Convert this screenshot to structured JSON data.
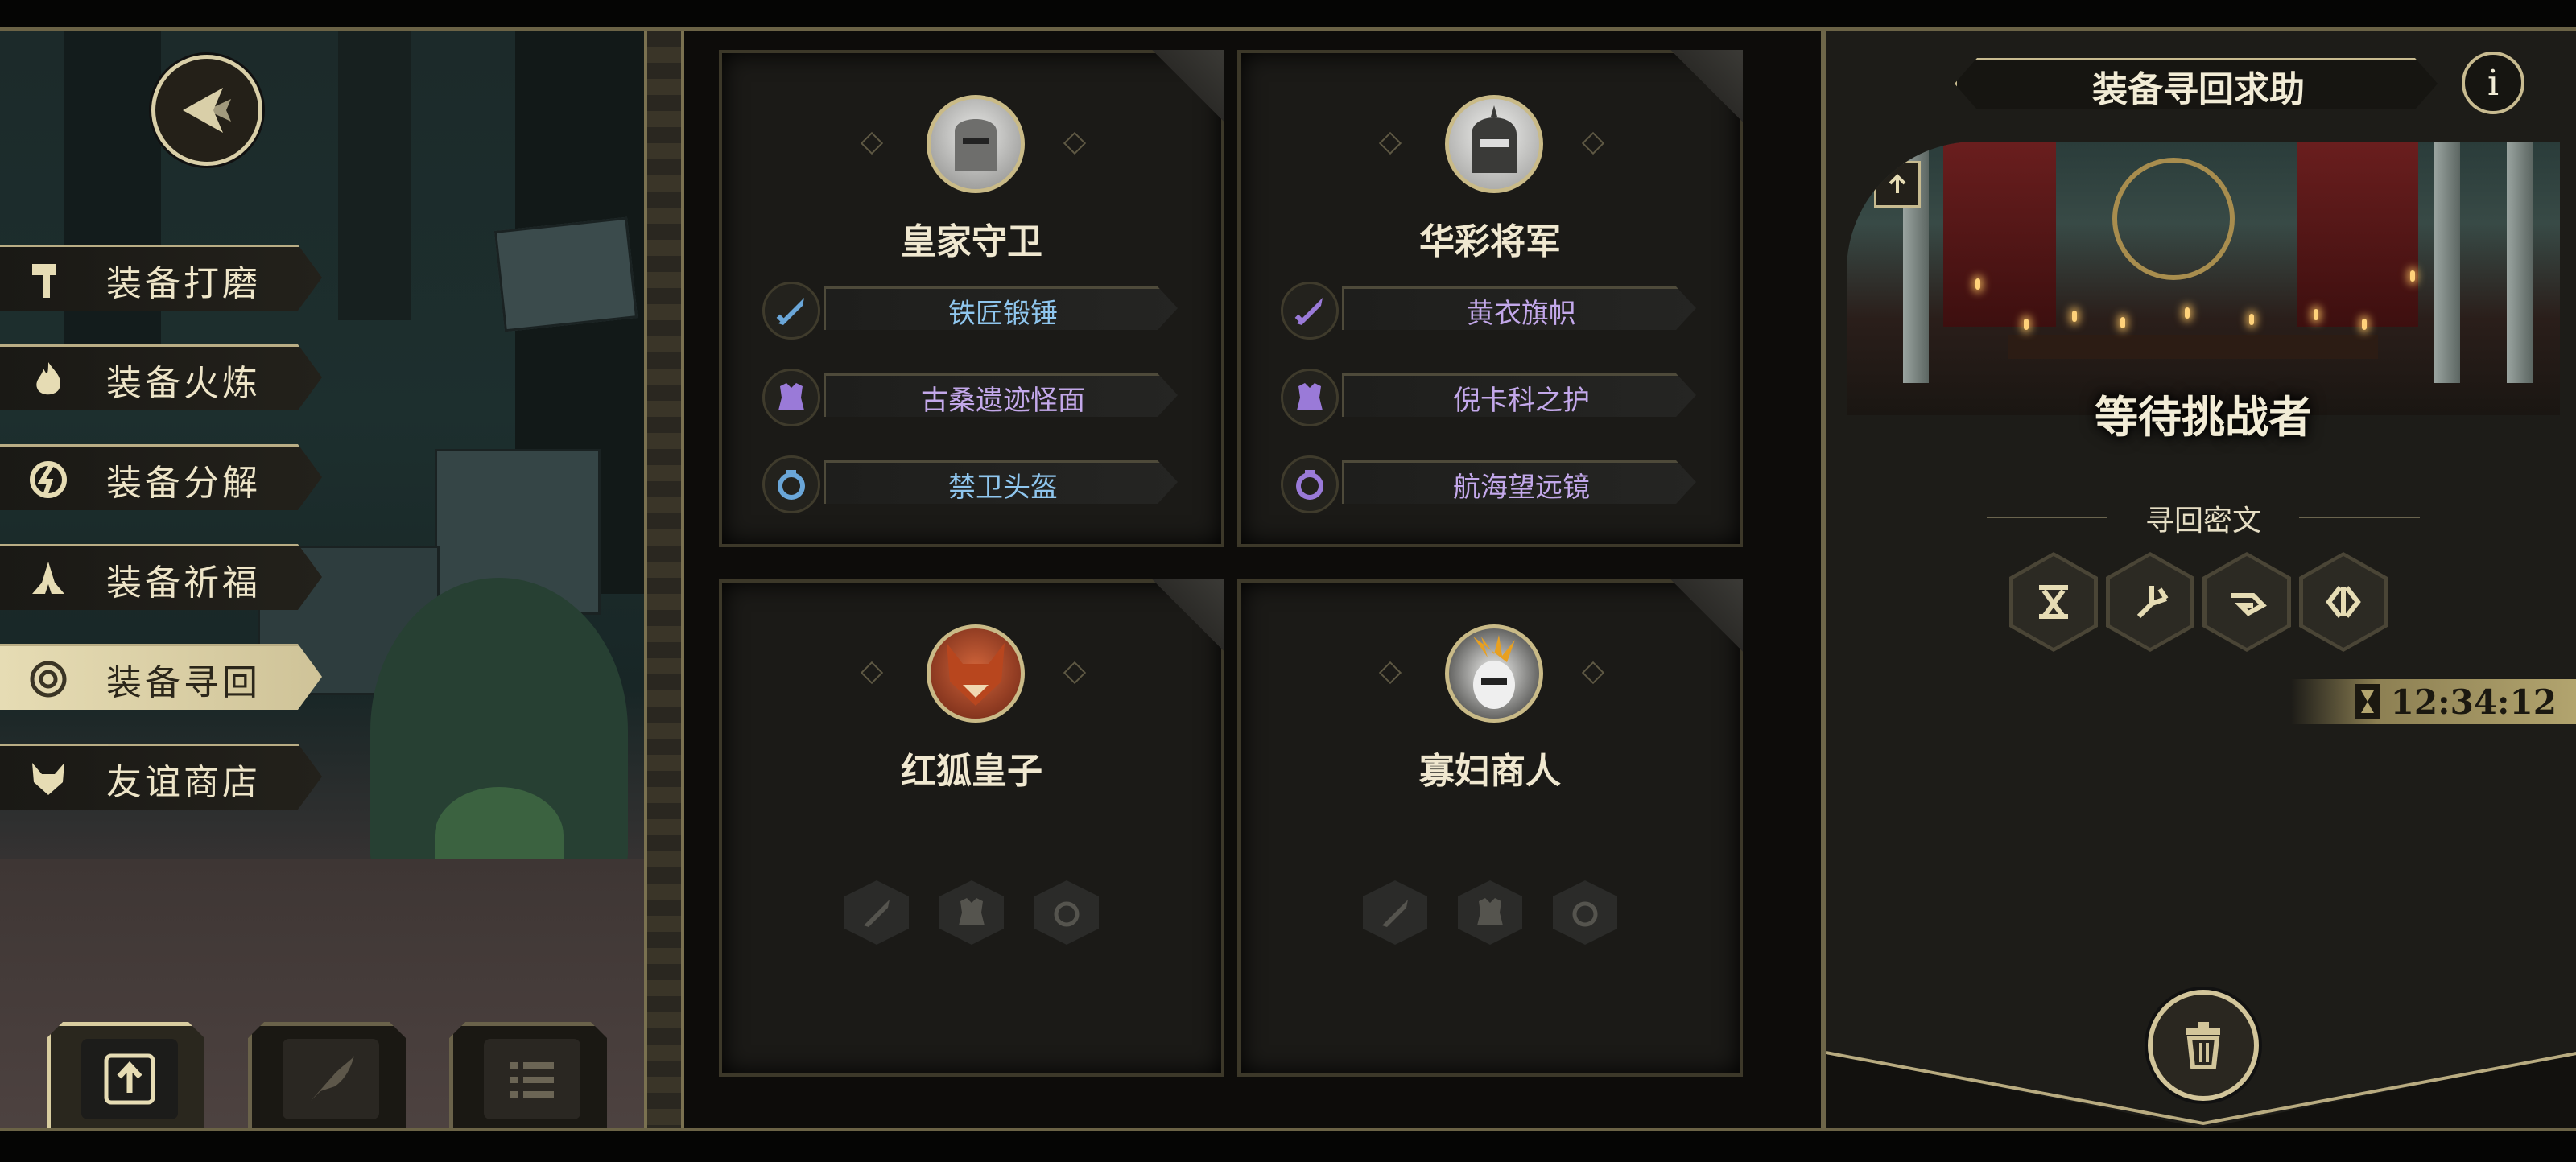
{
  "menu": {
    "items": [
      {
        "label": "装备打磨",
        "icon": "hammer-icon"
      },
      {
        "label": "装备火炼",
        "icon": "flame-icon"
      },
      {
        "label": "装备分解",
        "icon": "disassemble-icon"
      },
      {
        "label": "装备祈福",
        "icon": "praying-hands-icon"
      },
      {
        "label": "装备寻回",
        "icon": "target-icon",
        "active": true
      },
      {
        "label": "友谊商店",
        "icon": "fox-icon"
      }
    ]
  },
  "tools": [
    {
      "icon": "upload-icon",
      "active": true
    },
    {
      "icon": "feather-icon",
      "active": false
    },
    {
      "icon": "list-icon",
      "active": false
    }
  ],
  "cards": [
    {
      "name": "皇家守卫",
      "portrait": "knight-helmet-portrait",
      "equipment": [
        {
          "slot": "weapon",
          "icon": "sword-icon",
          "label": "铁匠锻锤",
          "color": "#8fc6ee"
        },
        {
          "slot": "armor",
          "icon": "armor-icon",
          "label": "古桑遗迹怪面",
          "color": "#c3a8ea"
        },
        {
          "slot": "ring",
          "icon": "ring-icon",
          "label": "禁卫头盔",
          "color": "#8fc6ee"
        }
      ]
    },
    {
      "name": "华彩将军",
      "portrait": "general-helmet-portrait",
      "equipment": [
        {
          "slot": "weapon",
          "icon": "sword-icon",
          "label": "黄衣旗帜",
          "color": "#c3a8ea"
        },
        {
          "slot": "armor",
          "icon": "armor-icon",
          "label": "倪卡科之护",
          "color": "#c3a8ea"
        },
        {
          "slot": "ring",
          "icon": "ring-icon",
          "label": "航海望远镜",
          "color": "#c3a8ea"
        }
      ]
    },
    {
      "name": "红狐皇子",
      "portrait": "red-fox-portrait",
      "equipment": []
    },
    {
      "name": "寡妇商人",
      "portrait": "widow-merchant-portrait",
      "equipment": []
    }
  ],
  "panel": {
    "title": "装备寻回求助",
    "info_symbol": "i",
    "status": "等待挑战者",
    "cipher_label": "寻回密文",
    "runes": [
      "rune-1-icon",
      "rune-2-icon",
      "rune-3-icon",
      "rune-4-icon"
    ],
    "timer": "12:34:12"
  },
  "colors": {
    "gold": "#c8bb90",
    "blue_item": "#8fc6ee",
    "purple_item": "#c3a8ea",
    "active_menu": "#e6dcb4"
  }
}
